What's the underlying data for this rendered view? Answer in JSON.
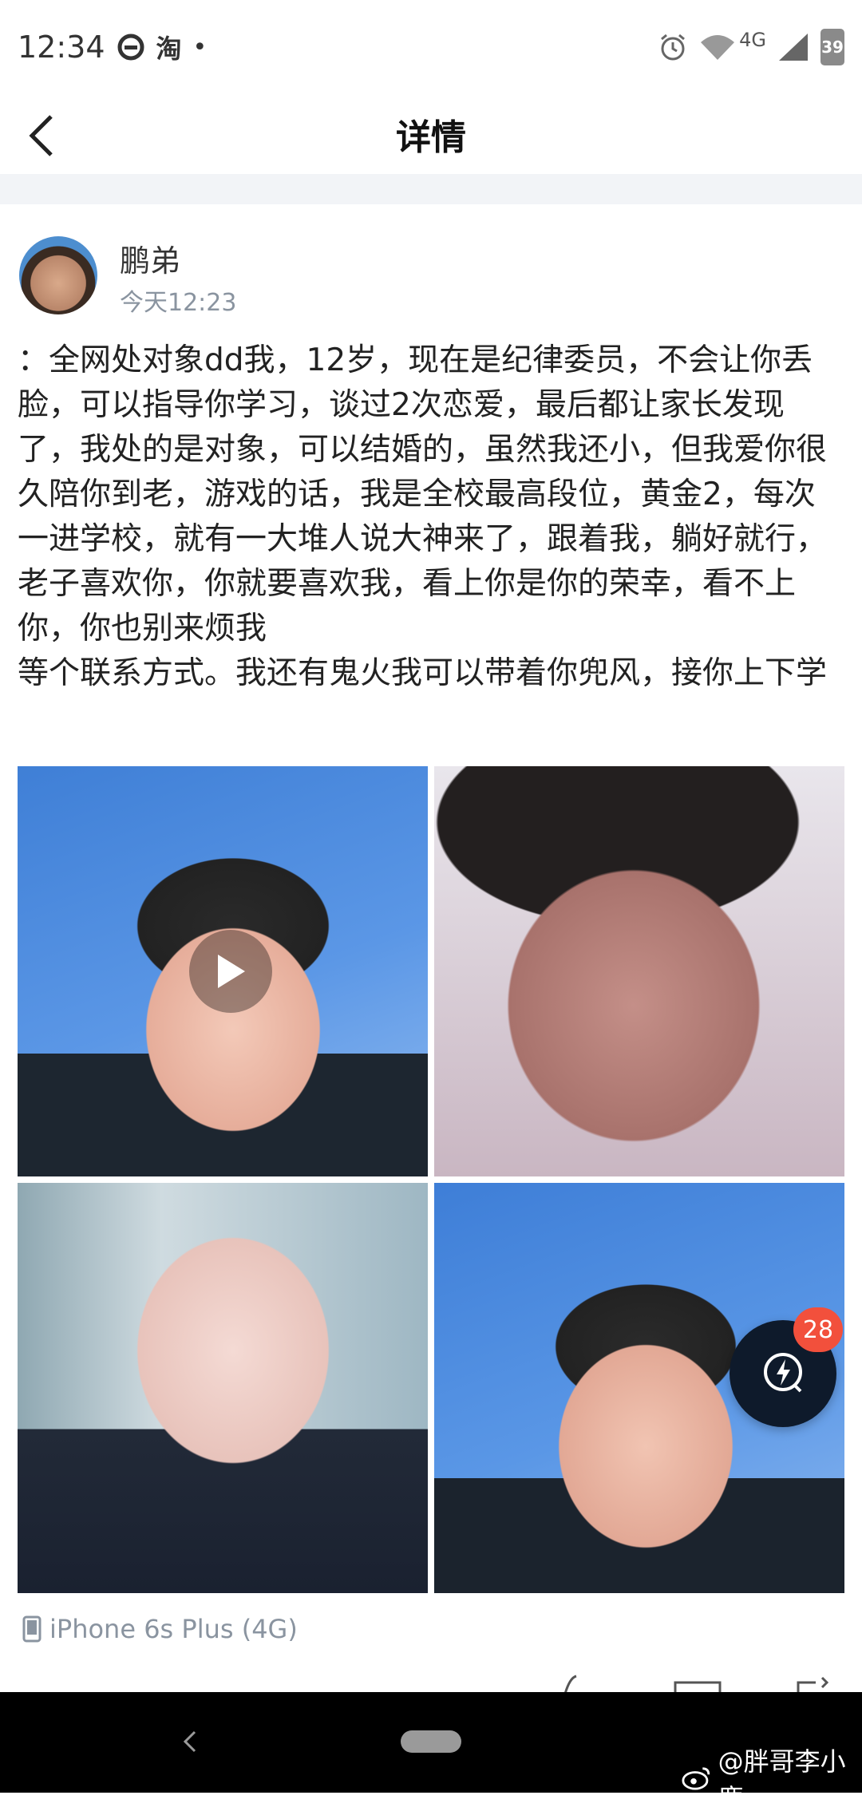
{
  "status_bar": {
    "time": "12:34",
    "app_taobao": "淘",
    "network": "4G",
    "battery": "39"
  },
  "header": {
    "title": "详情"
  },
  "post": {
    "author": "鹏弟",
    "time": "今天12:23",
    "text": "：全网处对象dd我，12岁，现在是纪律委员，不会让你丢脸，可以指导你学习，谈过2次恋爱，最后都让家长发现了，我处的是对象，可以结婚的，虽然我还小，但我爱你很久陪你到老，游戏的话，我是全校最高段位，黄金2，每次一进学校，就有一大堆人说大神来了，跟着我，躺好就行，老子喜欢你，你就要喜欢我，看上你是你的荣幸，看不上你，你也别来烦我\n等个联系方式。我还有鬼火我可以带着你兜风，接你上下学",
    "device": "iPhone 6s Plus (4G)"
  },
  "floating": {
    "badge_count": "28"
  },
  "watermark": {
    "text": "@胖哥李小鹿"
  },
  "colors": {
    "accent_dark": "#0e1a2b",
    "badge_red": "#f2503c",
    "meta_gray": "#8a94a0"
  }
}
